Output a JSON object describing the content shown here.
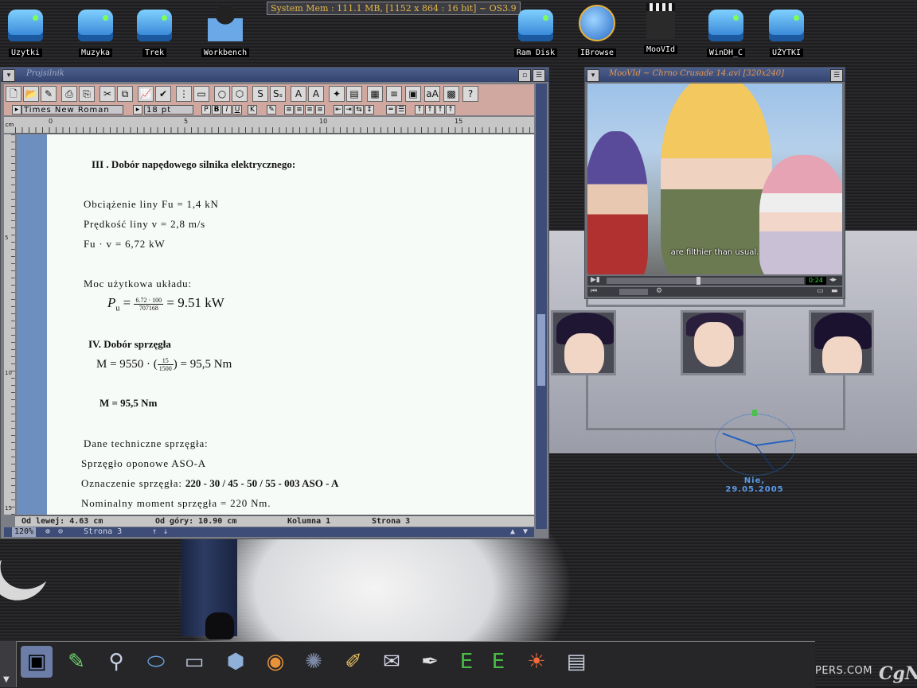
{
  "system_bar": {
    "text": "System Mem : 111.1 MB, [1152 x 864 : 16 bit] ~ OS3.9"
  },
  "desktop_icons": [
    {
      "label": "Uzytki"
    },
    {
      "label": "Muzyka"
    },
    {
      "label": "Trek"
    },
    {
      "label": "Workbench"
    },
    {
      "label": "Ram Disk"
    },
    {
      "label": "IBrowse"
    },
    {
      "label": "MooVId"
    },
    {
      "label": "WinDH_C"
    },
    {
      "label": "UŻYTKI"
    }
  ],
  "word_processor": {
    "title": "Projsilnik",
    "font_name": "Times New Roman",
    "font_size": "18 pt",
    "ruler": {
      "unit": "cm",
      "marks": [
        "0",
        "5",
        "10",
        "15"
      ]
    },
    "vruler": {
      "marks": [
        "5",
        "10",
        "15"
      ]
    },
    "document": {
      "heading3": "III . Dobór napędowego silnika elektrycznego:",
      "line_load": "Obciążenie liny  Fu =  1,4 kN",
      "line_speed": "Prędkość liny v = 2,8 m/s",
      "line_product": " Fu  · v = 6,72 kW",
      "line_useful_power": "Moc użytkowa układu:",
      "eq1": {
        "lhs": "P",
        "sub": "u",
        "num": "6.72 · 100",
        "den": "707168",
        "rhs": "= 9.51 kW"
      },
      "heading4": "IV. Dobór sprzęgła",
      "eq2": {
        "lhs": "M = 9550 · (",
        "num": "15",
        "den": "1500",
        "rhs": ") = 95,5 Nm"
      },
      "result": "M = 95,5 Nm",
      "coupling_title": " Dane techniczne sprzęgła:",
      "coupling_type": "Sprzęgło oponowe   ASO-A",
      "marking_label": "Oznaczenie sprzęgła:",
      "marking_value": "220 - 30 / 45 - 50 / 55 - 003 ASO - A",
      "nominal_moment": "Nominalny moment sprzęgła = 220 Nm."
    },
    "status": {
      "left": "Od lewej: 4.63 cm",
      "top": "Od góry: 10.90 cm",
      "column": "Kolumna 1",
      "page": "Strona 3"
    },
    "bottom": {
      "zoom": "120%",
      "page": "Strona 3"
    }
  },
  "video_player": {
    "title": "MooVId ~ Chrno Crusade 14.avi  [320x240]",
    "subtitle": "are filthier than usual.",
    "time": "0:24"
  },
  "clock": {
    "date": "Nie, 29.05.2005"
  },
  "branding": {
    "site": "PERS.COM",
    "logo": "CgN"
  }
}
